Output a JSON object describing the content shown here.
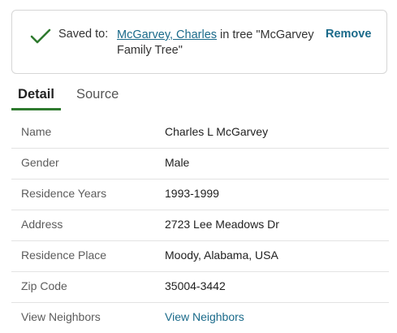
{
  "saved": {
    "label": "Saved to:",
    "person_link": "McGarvey, Charles",
    "tree_text": " in tree \"McGarvey Family Tree\"",
    "remove_label": "Remove",
    "accent_color": "#2f7a2f",
    "link_color": "#1a6a8a"
  },
  "tabs": [
    {
      "label": "Detail",
      "active": true
    },
    {
      "label": "Source",
      "active": false
    }
  ],
  "details": [
    {
      "label": "Name",
      "value": "Charles L McGarvey"
    },
    {
      "label": "Gender",
      "value": "Male"
    },
    {
      "label": "Residence Years",
      "value": "1993-1999"
    },
    {
      "label": "Address",
      "value": "2723 Lee Meadows Dr"
    },
    {
      "label": "Residence Place",
      "value": "Moody, Alabama, USA"
    },
    {
      "label": "Zip Code",
      "value": "35004-3442"
    },
    {
      "label": "View Neighbors",
      "value": "View Neighbors",
      "is_link": true
    }
  ]
}
